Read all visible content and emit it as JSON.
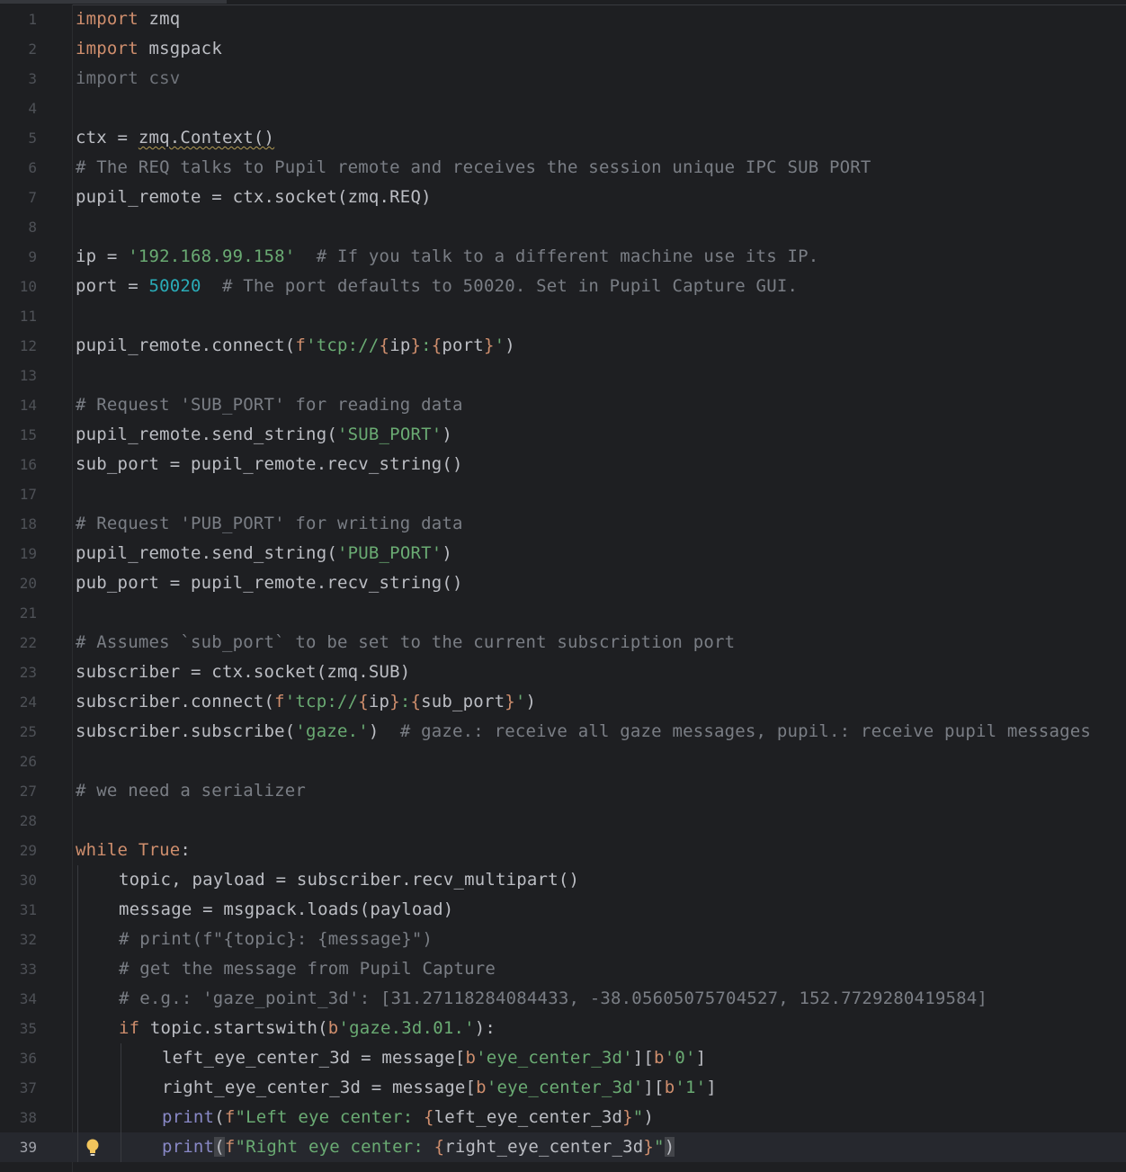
{
  "editor": {
    "current_line": 39,
    "colors": {
      "background": "#1e1f22",
      "keyword": "#cf8e6d",
      "string": "#6aab73",
      "number": "#2aacb8",
      "comment": "#7a7e85",
      "builtin": "#8888c6",
      "text": "#bcbec4"
    },
    "lines": [
      {
        "n": "1",
        "indent": 0,
        "tokens": [
          {
            "t": "kw",
            "v": "import"
          },
          {
            "t": "tx",
            "v": " zmq"
          }
        ]
      },
      {
        "n": "2",
        "indent": 0,
        "tokens": [
          {
            "t": "kw",
            "v": "import"
          },
          {
            "t": "tx",
            "v": " msgpack"
          }
        ]
      },
      {
        "n": "3",
        "indent": 0,
        "tokens": [
          {
            "t": "dim",
            "v": "import csv"
          }
        ]
      },
      {
        "n": "4",
        "indent": 0,
        "tokens": []
      },
      {
        "n": "5",
        "indent": 0,
        "tokens": [
          {
            "t": "tx",
            "v": "ctx = "
          },
          {
            "t": "squig",
            "v": "zmq.Context()"
          }
        ]
      },
      {
        "n": "6",
        "indent": 0,
        "tokens": [
          {
            "t": "cm",
            "v": "# The REQ talks to Pupil remote and receives the session unique IPC SUB PORT"
          }
        ]
      },
      {
        "n": "7",
        "indent": 0,
        "tokens": [
          {
            "t": "tx",
            "v": "pupil_remote = ctx.socket(zmq.REQ)"
          }
        ]
      },
      {
        "n": "8",
        "indent": 0,
        "tokens": []
      },
      {
        "n": "9",
        "indent": 0,
        "tokens": [
          {
            "t": "tx",
            "v": "ip = "
          },
          {
            "t": "str",
            "v": "'192.168.99.158'"
          },
          {
            "t": "tx",
            "v": "  "
          },
          {
            "t": "cm",
            "v": "# If you talk to a different machine use its IP."
          }
        ]
      },
      {
        "n": "10",
        "indent": 0,
        "tokens": [
          {
            "t": "tx",
            "v": "port = "
          },
          {
            "t": "num",
            "v": "50020"
          },
          {
            "t": "tx",
            "v": "  "
          },
          {
            "t": "cm",
            "v": "# The port defaults to 50020. Set in Pupil Capture GUI."
          }
        ]
      },
      {
        "n": "11",
        "indent": 0,
        "tokens": []
      },
      {
        "n": "12",
        "indent": 0,
        "tokens": [
          {
            "t": "tx",
            "v": "pupil_remote.connect("
          },
          {
            "t": "fb",
            "v": "f"
          },
          {
            "t": "str",
            "v": "'tcp://"
          },
          {
            "t": "fb",
            "v": "{"
          },
          {
            "t": "tx",
            "v": "ip"
          },
          {
            "t": "fb",
            "v": "}"
          },
          {
            "t": "str",
            "v": ":"
          },
          {
            "t": "fb",
            "v": "{"
          },
          {
            "t": "tx",
            "v": "port"
          },
          {
            "t": "fb",
            "v": "}"
          },
          {
            "t": "str",
            "v": "'"
          },
          {
            "t": "tx",
            "v": ")"
          }
        ]
      },
      {
        "n": "13",
        "indent": 0,
        "tokens": []
      },
      {
        "n": "14",
        "indent": 0,
        "tokens": [
          {
            "t": "cm",
            "v": "# Request 'SUB_PORT' for reading data"
          }
        ]
      },
      {
        "n": "15",
        "indent": 0,
        "tokens": [
          {
            "t": "tx",
            "v": "pupil_remote.send_string("
          },
          {
            "t": "str",
            "v": "'SUB_PORT'"
          },
          {
            "t": "tx",
            "v": ")"
          }
        ]
      },
      {
        "n": "16",
        "indent": 0,
        "tokens": [
          {
            "t": "tx",
            "v": "sub_port = pupil_remote.recv_string()"
          }
        ]
      },
      {
        "n": "17",
        "indent": 0,
        "tokens": []
      },
      {
        "n": "18",
        "indent": 0,
        "tokens": [
          {
            "t": "cm",
            "v": "# Request 'PUB_PORT' for writing data"
          }
        ]
      },
      {
        "n": "19",
        "indent": 0,
        "tokens": [
          {
            "t": "tx",
            "v": "pupil_remote.send_string("
          },
          {
            "t": "str",
            "v": "'PUB_PORT'"
          },
          {
            "t": "tx",
            "v": ")"
          }
        ]
      },
      {
        "n": "20",
        "indent": 0,
        "tokens": [
          {
            "t": "tx",
            "v": "pub_port = pupil_remote.recv_string()"
          }
        ]
      },
      {
        "n": "21",
        "indent": 0,
        "tokens": []
      },
      {
        "n": "22",
        "indent": 0,
        "tokens": [
          {
            "t": "cm",
            "v": "# Assumes `sub_port` to be set to the current subscription port"
          }
        ]
      },
      {
        "n": "23",
        "indent": 0,
        "tokens": [
          {
            "t": "tx",
            "v": "subscriber = ctx.socket(zmq.SUB)"
          }
        ]
      },
      {
        "n": "24",
        "indent": 0,
        "tokens": [
          {
            "t": "tx",
            "v": "subscriber.connect("
          },
          {
            "t": "fb",
            "v": "f"
          },
          {
            "t": "str",
            "v": "'tcp://"
          },
          {
            "t": "fb",
            "v": "{"
          },
          {
            "t": "tx",
            "v": "ip"
          },
          {
            "t": "fb",
            "v": "}"
          },
          {
            "t": "str",
            "v": ":"
          },
          {
            "t": "fb",
            "v": "{"
          },
          {
            "t": "tx",
            "v": "sub_port"
          },
          {
            "t": "fb",
            "v": "}"
          },
          {
            "t": "str",
            "v": "'"
          },
          {
            "t": "tx",
            "v": ")"
          }
        ]
      },
      {
        "n": "25",
        "indent": 0,
        "tokens": [
          {
            "t": "tx",
            "v": "subscriber.subscribe("
          },
          {
            "t": "str",
            "v": "'gaze.'"
          },
          {
            "t": "tx",
            "v": ")  "
          },
          {
            "t": "cm",
            "v": "# gaze.: receive all gaze messages, pupil.: receive pupil messages"
          }
        ]
      },
      {
        "n": "26",
        "indent": 0,
        "tokens": []
      },
      {
        "n": "27",
        "indent": 0,
        "tokens": [
          {
            "t": "cm",
            "v": "# we need a serializer"
          }
        ]
      },
      {
        "n": "28",
        "indent": 0,
        "tokens": []
      },
      {
        "n": "29",
        "indent": 0,
        "tokens": [
          {
            "t": "kw",
            "v": "while"
          },
          {
            "t": "tx",
            "v": " "
          },
          {
            "t": "kw",
            "v": "True"
          },
          {
            "t": "tx",
            "v": ":"
          }
        ]
      },
      {
        "n": "30",
        "indent": 1,
        "tokens": [
          {
            "t": "tx",
            "v": "topic, payload = subscriber.recv_multipart()"
          }
        ]
      },
      {
        "n": "31",
        "indent": 1,
        "tokens": [
          {
            "t": "tx",
            "v": "message = msgpack.loads(payload)"
          }
        ]
      },
      {
        "n": "32",
        "indent": 1,
        "tokens": [
          {
            "t": "cm",
            "v": "# print(f\"{topic}: {message}\")"
          }
        ]
      },
      {
        "n": "33",
        "indent": 1,
        "tokens": [
          {
            "t": "cm",
            "v": "# get the message from Pupil Capture"
          }
        ]
      },
      {
        "n": "34",
        "indent": 1,
        "tokens": [
          {
            "t": "cm",
            "v": "# e.g.: 'gaze_point_3d': [31.27118284084433, -38.05605075704527, 152.7729280419584]"
          }
        ]
      },
      {
        "n": "35",
        "indent": 1,
        "tokens": [
          {
            "t": "kw",
            "v": "if"
          },
          {
            "t": "tx",
            "v": " topic.startswith("
          },
          {
            "t": "fb",
            "v": "b"
          },
          {
            "t": "str",
            "v": "'gaze.3d.01.'"
          },
          {
            "t": "tx",
            "v": "):"
          }
        ]
      },
      {
        "n": "36",
        "indent": 2,
        "tokens": [
          {
            "t": "tx",
            "v": "left_eye_center_3d = message["
          },
          {
            "t": "fb",
            "v": "b"
          },
          {
            "t": "str",
            "v": "'eye_center_3d'"
          },
          {
            "t": "tx",
            "v": "]["
          },
          {
            "t": "fb",
            "v": "b"
          },
          {
            "t": "str",
            "v": "'0'"
          },
          {
            "t": "tx",
            "v": "]"
          }
        ]
      },
      {
        "n": "37",
        "indent": 2,
        "tokens": [
          {
            "t": "tx",
            "v": "right_eye_center_3d = message["
          },
          {
            "t": "fb",
            "v": "b"
          },
          {
            "t": "str",
            "v": "'eye_center_3d'"
          },
          {
            "t": "tx",
            "v": "]["
          },
          {
            "t": "fb",
            "v": "b"
          },
          {
            "t": "str",
            "v": "'1'"
          },
          {
            "t": "tx",
            "v": "]"
          }
        ]
      },
      {
        "n": "38",
        "indent": 2,
        "tokens": [
          {
            "t": "bi",
            "v": "print"
          },
          {
            "t": "tx",
            "v": "("
          },
          {
            "t": "fb",
            "v": "f"
          },
          {
            "t": "str",
            "v": "\"Left eye center: "
          },
          {
            "t": "fb",
            "v": "{"
          },
          {
            "t": "tx",
            "v": "left_eye_center_3d"
          },
          {
            "t": "fb",
            "v": "}"
          },
          {
            "t": "str",
            "v": "\""
          },
          {
            "t": "tx",
            "v": ")"
          }
        ]
      },
      {
        "n": "39",
        "indent": 2,
        "tokens": [
          {
            "t": "bi",
            "v": "print"
          },
          {
            "t": "hl",
            "v": "("
          },
          {
            "t": "fb",
            "v": "f"
          },
          {
            "t": "str",
            "v": "\"Right eye center: "
          },
          {
            "t": "fb",
            "v": "{"
          },
          {
            "t": "tx",
            "v": "right_eye_center_3d"
          },
          {
            "t": "fb",
            "v": "}"
          },
          {
            "t": "str",
            "v": "\""
          },
          {
            "t": "hl",
            "v": ")"
          }
        ]
      }
    ]
  }
}
